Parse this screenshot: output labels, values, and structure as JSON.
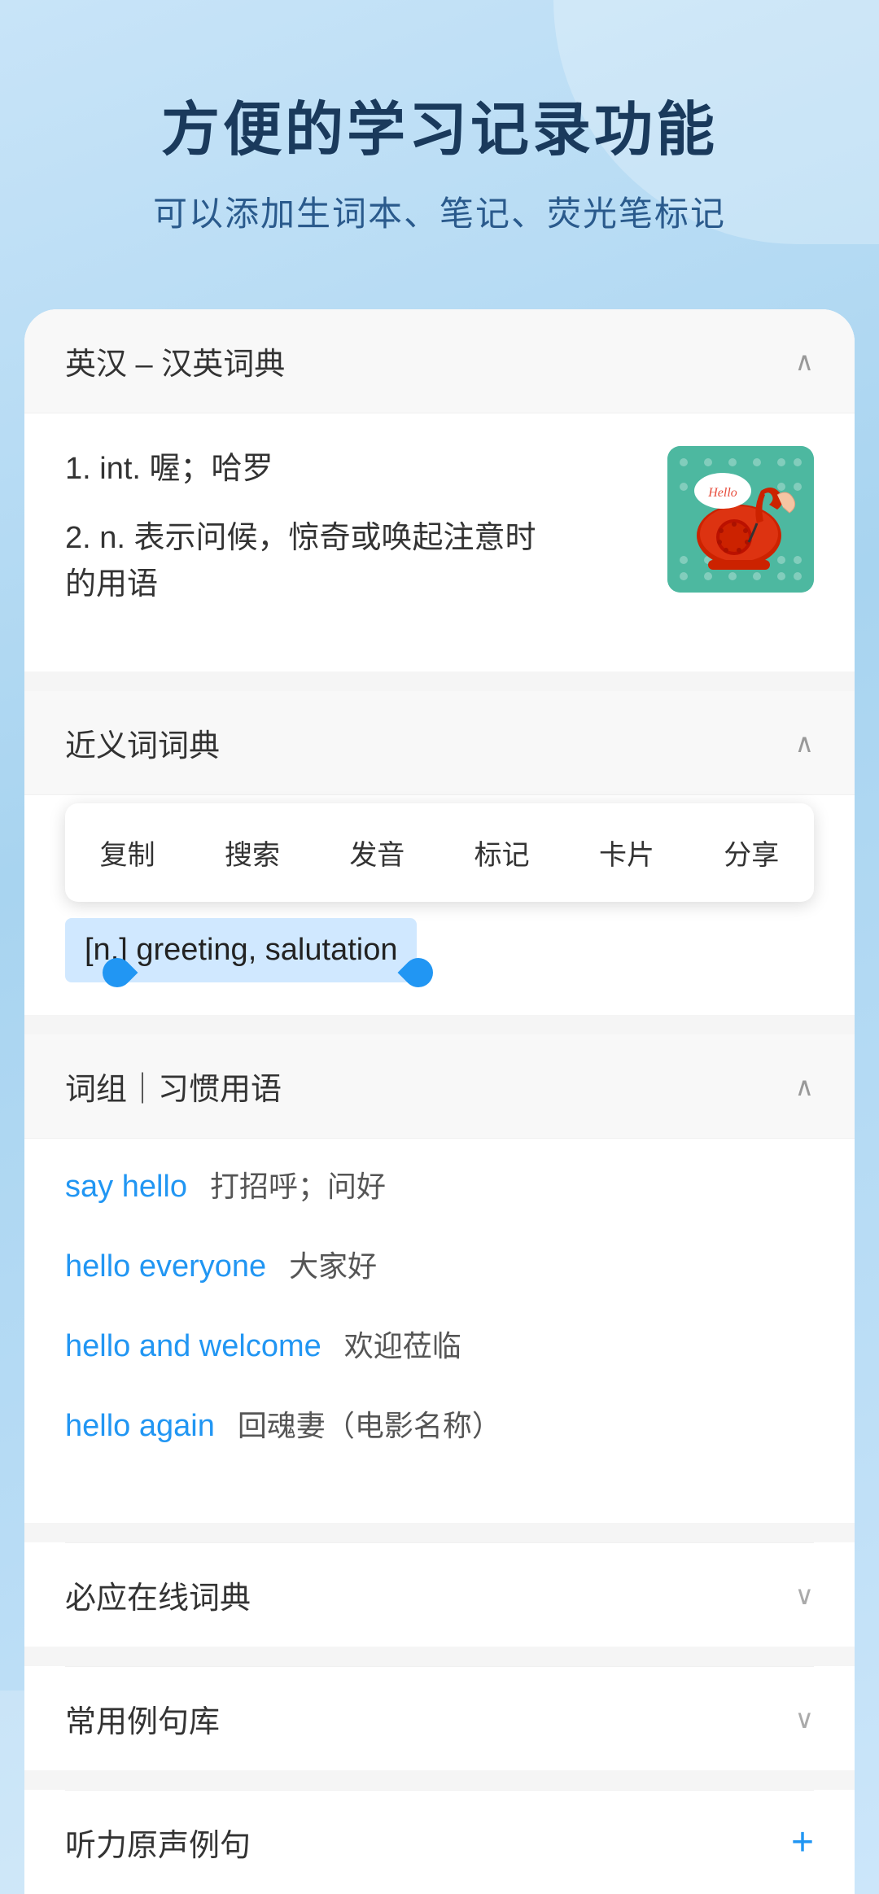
{
  "header": {
    "title": "方便的学习记录功能",
    "subtitle": "可以添加生词本、笔记、荧光笔标记"
  },
  "english_chinese_dict": {
    "section_title": "英汉 – 汉英词典",
    "definitions": [
      {
        "number": "1.",
        "part_of_speech": "int.",
        "text": "喔；哈罗"
      },
      {
        "number": "2.",
        "part_of_speech": "n.",
        "text": "表示问候，惊奇或唤起注意时的用语"
      }
    ]
  },
  "synonym_dict": {
    "section_title": "近义词词典",
    "context_menu": {
      "items": [
        "复制",
        "搜索",
        "发音",
        "标记",
        "卡片",
        "分享"
      ]
    },
    "selected_text": "[n.] greeting, salutation"
  },
  "phrases": {
    "section_title": "词组｜习惯用语",
    "items": [
      {
        "en": "say hello",
        "zh": "打招呼；问好"
      },
      {
        "en": "hello everyone",
        "zh": "大家好"
      },
      {
        "en": "hello and welcome",
        "zh": "欢迎莅临"
      },
      {
        "en": "hello again",
        "zh": "回魂妻（电影名称）"
      }
    ]
  },
  "biyingzaixian": {
    "section_title": "必应在线词典"
  },
  "common_sentences": {
    "section_title": "常用例句库"
  },
  "listening": {
    "section_title": "听力原声例句"
  },
  "icons": {
    "chevron_up": "∧",
    "chevron_down": "∨",
    "plus": "+"
  }
}
